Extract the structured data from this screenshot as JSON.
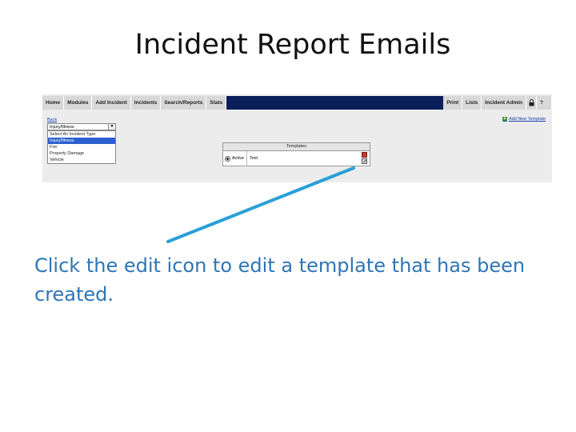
{
  "slide": {
    "title": "Incident Report Emails",
    "caption": "Click the edit icon to edit a template that has been created."
  },
  "navbar": {
    "items": [
      "Home",
      "Modules",
      "Add Incident",
      "Incidents",
      "Search/Reports",
      "Stats"
    ],
    "right_items": [
      "Print",
      "Lists",
      "Incident Admin"
    ],
    "lock_icon": "lock-icon",
    "help_label": "?"
  },
  "content": {
    "back_label": "Back",
    "select_value": "Injury/Illness",
    "dropdown_options": [
      "Select An Incident Type",
      "Injury/Illness",
      "Fire",
      "Property Damage",
      "Vehicle"
    ],
    "selected_index": 1,
    "add_template_label": "Add New Template",
    "templates": {
      "header": "Templates",
      "rows": [
        {
          "status": "Active",
          "name": "Test"
        }
      ]
    }
  },
  "colors": {
    "navbar_fill": "#0a1f5c",
    "caption_text": "#2e75b6",
    "pointer_line": "#2a9fd8",
    "link": "#1a3fb0"
  }
}
